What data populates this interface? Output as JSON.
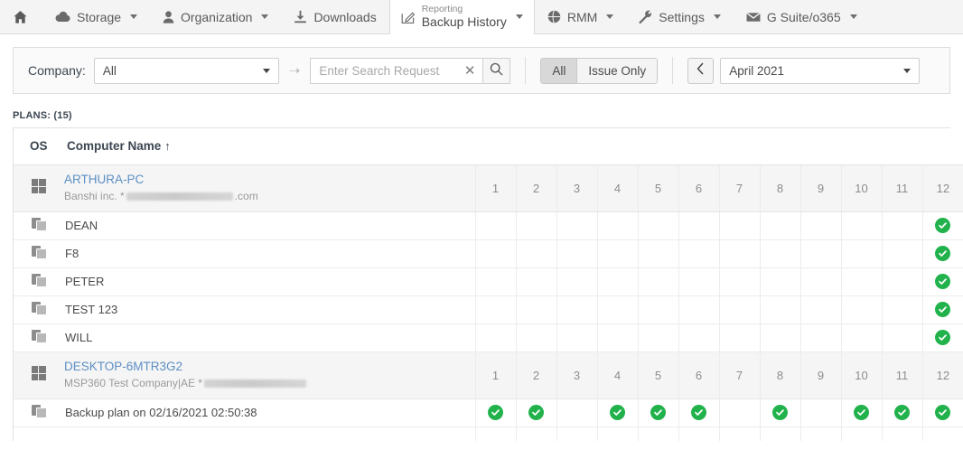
{
  "navbar": {
    "home_icon": "home-icon",
    "items": [
      {
        "label": "Storage",
        "icon": "cloud-icon",
        "caret": true,
        "active": false
      },
      {
        "label": "Organization",
        "icon": "user-icon",
        "caret": true,
        "active": false
      },
      {
        "label": "Downloads",
        "icon": "download-icon",
        "caret": false,
        "active": false
      }
    ],
    "active_tab": {
      "sub_label": "Reporting",
      "main_label": "Backup History",
      "icon": "edit-icon",
      "caret": true
    },
    "items_right": [
      {
        "label": "RMM",
        "icon": "globe-icon",
        "caret": true
      },
      {
        "label": "Settings",
        "icon": "wrench-icon",
        "caret": true
      },
      {
        "label": "G Suite/o365",
        "icon": "envelope-icon",
        "caret": true
      }
    ]
  },
  "toolbar": {
    "company_label": "Company:",
    "company_value": "All",
    "search_placeholder": "Enter Search Request",
    "search_value": "",
    "clear_icon": "close-icon",
    "search_icon": "search-icon",
    "arrow_icon": "arrow-right-icon",
    "filter_segments": [
      {
        "label": "All",
        "selected": true
      },
      {
        "label": "Issue Only",
        "selected": false
      }
    ],
    "prev_icon": "chevron-left-icon",
    "month_value": "April 2021"
  },
  "plans_label": "PLANS: (15)",
  "table": {
    "headers": {
      "os": "OS",
      "name": "Computer Name",
      "sort_arrow": "↑"
    },
    "days": [
      "1",
      "2",
      "3",
      "4",
      "5",
      "6",
      "7",
      "8",
      "9",
      "10",
      "11",
      "12"
    ],
    "rows": [
      {
        "type": "computer",
        "os_icon": "windows-icon",
        "name": "ARTHURA-PC",
        "sub_prefix": "Banshi inc. *",
        "sub_suffix": ".com",
        "redact_width": 118,
        "cells": [
          "1",
          "2",
          "3",
          "4",
          "5",
          "6",
          "7",
          "8",
          "9",
          "10",
          "11",
          "12"
        ]
      },
      {
        "type": "plan",
        "icon": "backup-plan-icon",
        "name": "DEAN",
        "cells": [
          "",
          "",
          "",
          "",
          "",
          "",
          "",
          "",
          "",
          "",
          "",
          "check"
        ]
      },
      {
        "type": "plan",
        "icon": "backup-plan-icon",
        "name": "F8",
        "cells": [
          "",
          "",
          "",
          "",
          "",
          "",
          "",
          "",
          "",
          "",
          "",
          "check"
        ]
      },
      {
        "type": "plan",
        "icon": "backup-plan-icon",
        "name": "PETER",
        "cells": [
          "",
          "",
          "",
          "",
          "",
          "",
          "",
          "",
          "",
          "",
          "",
          "check"
        ]
      },
      {
        "type": "plan",
        "icon": "backup-plan-icon",
        "name": "TEST 123",
        "cells": [
          "",
          "",
          "",
          "",
          "",
          "",
          "",
          "",
          "",
          "",
          "",
          "check"
        ]
      },
      {
        "type": "plan",
        "icon": "backup-plan-icon",
        "name": "WILL",
        "cells": [
          "",
          "",
          "",
          "",
          "",
          "",
          "",
          "",
          "",
          "",
          "",
          "check"
        ]
      },
      {
        "type": "computer",
        "os_icon": "windows-icon",
        "name": "DESKTOP-6MTR3G2",
        "sub_prefix": "MSP360 Test Company|AE *",
        "sub_suffix": "",
        "redact_width": 113,
        "cells": [
          "1",
          "2",
          "3",
          "4",
          "5",
          "6",
          "7",
          "8",
          "9",
          "10",
          "11",
          "12"
        ]
      },
      {
        "type": "plan",
        "icon": "backup-plan-icon",
        "name": "Backup plan on 02/16/2021 02:50:38",
        "cells": [
          "check",
          "check",
          "",
          "check",
          "check",
          "check",
          "",
          "check",
          "",
          "check",
          "check",
          "check"
        ]
      },
      {
        "type": "plan-partial",
        "icon": "backup-plan-icon",
        "name": "",
        "cells": [
          "",
          "",
          "",
          "",
          "",
          "",
          "",
          "",
          "",
          "",
          "",
          ""
        ]
      }
    ]
  },
  "colors": {
    "check_green": "#22b24c",
    "link_blue": "#5c8fc4",
    "nav_bg": "#f4f4f4",
    "row_header_bg": "#f5f5f5"
  }
}
